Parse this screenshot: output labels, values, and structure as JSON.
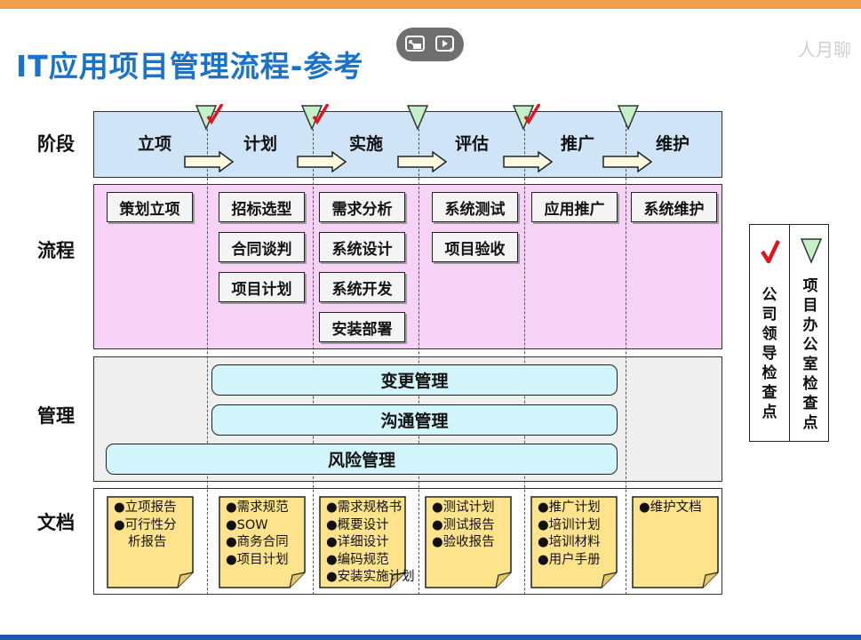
{
  "title": "IT应用项目管理流程-参考",
  "watermark": "人月聊",
  "media_controls": {
    "icons": [
      "picture-in-picture-icon",
      "smart-video-icon"
    ]
  },
  "row_labels": {
    "stage": "阶段",
    "flow": "流程",
    "management": "管理",
    "documents": "文档"
  },
  "stages": [
    {
      "name": "立项",
      "marker": ""
    },
    {
      "name": "计划",
      "marker": "triangle-check"
    },
    {
      "name": "实施",
      "marker": "triangle-check"
    },
    {
      "name": "评估",
      "marker": "triangle"
    },
    {
      "name": "推广",
      "marker": "triangle-check"
    },
    {
      "name": "维护",
      "marker": "triangle"
    }
  ],
  "flow": [
    [
      "策划立项"
    ],
    [
      "招标选型",
      "合同谈判",
      "项目计划"
    ],
    [
      "需求分析",
      "系统设计",
      "系统开发",
      "安装部署"
    ],
    [
      "系统测试",
      "项目验收"
    ],
    [
      "应用推广"
    ],
    [
      "系统维护"
    ]
  ],
  "management": [
    "变更管理",
    "沟通管理",
    "风险管理"
  ],
  "documents": [
    [
      "●立项报告",
      "●可行性分",
      "析报告"
    ],
    [
      "●需求规范",
      "●SOW",
      "●商务合同",
      "●项目计划"
    ],
    [
      "●需求规格书",
      "●概要设计",
      "●详细设计",
      "●编码规范",
      "●安装实施计划"
    ],
    [
      "●测试计划",
      "●测试报告",
      "●验收报告"
    ],
    [
      "●推广计划",
      "●培训计划",
      "●培训材料",
      "●用户手册"
    ],
    [
      "●维护文档"
    ]
  ],
  "legend": {
    "check_label": "公司领导检查点",
    "triangle_label": "项目办公室检查点"
  },
  "colors": {
    "title": "#1a73c9",
    "stage_band": "#cfe4f6",
    "flow_band": "#f6d2f6",
    "management_band": "#efefef",
    "management_bar": "#d2f5fb",
    "note": "#fde48c",
    "triangle": "#c4f0c7",
    "check": "#e0141e",
    "top_strip": "#f0a04b",
    "bottom_strip": "#1e5aa8"
  }
}
